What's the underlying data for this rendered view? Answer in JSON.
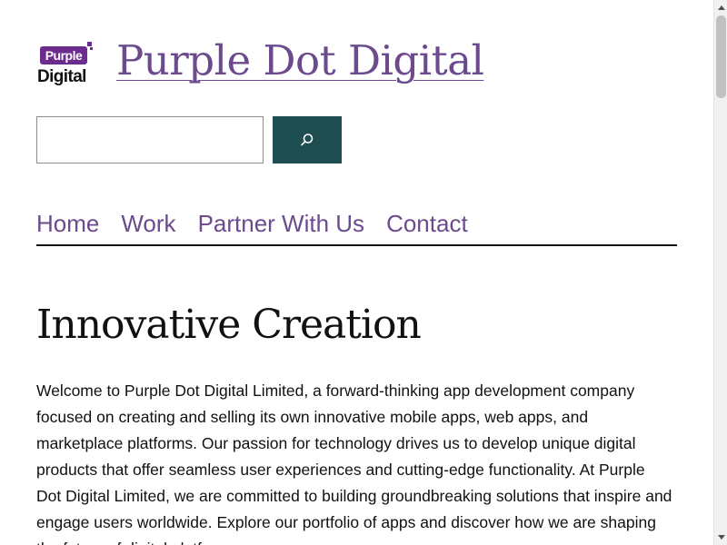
{
  "header": {
    "logo": {
      "top_word": "Purple",
      "bottom_word": "Digital",
      "brand_color": "#6b2c8e"
    },
    "site_title": "Purple Dot Digital"
  },
  "search": {
    "value": "",
    "placeholder": "",
    "button_icon": "search-icon",
    "button_color": "#1f4e52"
  },
  "nav": {
    "items": [
      {
        "label": "Home"
      },
      {
        "label": "Work"
      },
      {
        "label": "Partner With Us"
      },
      {
        "label": "Contact"
      }
    ],
    "link_color": "#6b4a8e"
  },
  "main": {
    "heading": "Innovative Creation",
    "paragraph": "Welcome to Purple Dot Digital Limited, a forward-thinking app development company focused on creating and selling its own innovative mobile apps, web apps, and marketplace platforms. Our passion for technology drives us to develop unique digital products that offer seamless user experiences and cutting-edge functionality. At Purple Dot Digital Limited, we are committed to building groundbreaking solutions that inspire and engage users worldwide. Explore our portfolio of apps and discover how we are shaping the future of digital platforms."
  }
}
